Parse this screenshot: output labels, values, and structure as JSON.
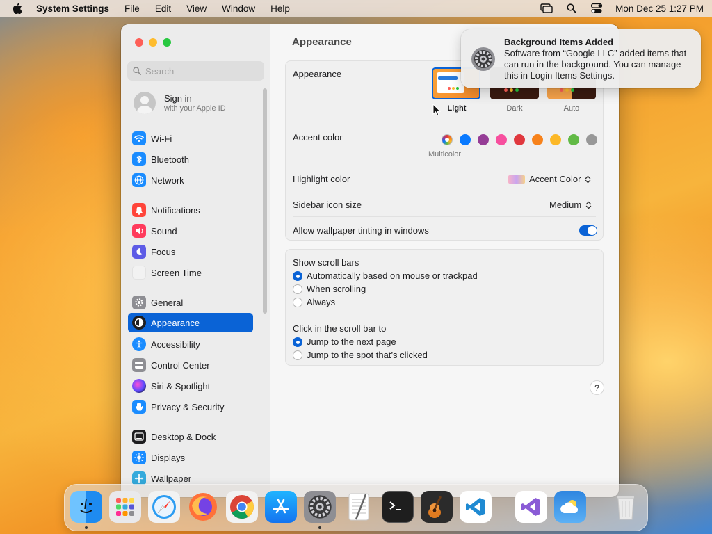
{
  "menubar": {
    "app_name": "System Settings",
    "menus": [
      "File",
      "Edit",
      "View",
      "Window",
      "Help"
    ],
    "datetime": "Mon Dec 25  1:27 PM"
  },
  "sidebar": {
    "search_placeholder": "Search",
    "signin": {
      "title": "Sign in",
      "subtitle": "with your Apple ID"
    },
    "items": [
      {
        "label": "Wi-Fi",
        "icon": "wifi-icon",
        "color": "#1a8cff"
      },
      {
        "label": "Bluetooth",
        "icon": "bluetooth-icon",
        "color": "#1a8cff"
      },
      {
        "label": "Network",
        "icon": "globe-icon",
        "color": "#1a8cff"
      },
      {
        "label": "Notifications",
        "icon": "bell-icon",
        "color": "#ff453a"
      },
      {
        "label": "Sound",
        "icon": "speaker-icon",
        "color": "#ff3b5c"
      },
      {
        "label": "Focus",
        "icon": "moon-icon",
        "color": "#5e5ce6"
      },
      {
        "label": "Screen Time",
        "icon": "hourglass-icon",
        "color": "#f2f2f2"
      },
      {
        "label": "General",
        "icon": "gear-icon",
        "color": "#8e8e93"
      },
      {
        "label": "Appearance",
        "icon": "appearance-icon",
        "color": "#1d1d1f",
        "active": true
      },
      {
        "label": "Accessibility",
        "icon": "accessibility-icon",
        "color": "#1a8cff"
      },
      {
        "label": "Control Center",
        "icon": "control-center-icon",
        "color": "#8e8e93"
      },
      {
        "label": "Siri & Spotlight",
        "icon": "siri-icon",
        "color": "#222222"
      },
      {
        "label": "Privacy & Security",
        "icon": "hand-icon",
        "color": "#1a8cff"
      },
      {
        "label": "Desktop & Dock",
        "icon": "dock-icon",
        "color": "#1d1d1f"
      },
      {
        "label": "Displays",
        "icon": "sun-icon",
        "color": "#1a8cff"
      },
      {
        "label": "Wallpaper",
        "icon": "wallpaper-icon",
        "color": "#34aadc"
      }
    ]
  },
  "main": {
    "title": "Appearance",
    "appearance": {
      "label": "Appearance",
      "options": [
        {
          "label": "Light",
          "selected": true
        },
        {
          "label": "Dark",
          "selected": false
        },
        {
          "label": "Auto",
          "selected": false
        }
      ]
    },
    "accent": {
      "label": "Accent color",
      "selected_label": "Multicolor",
      "colors": [
        "multicolor",
        "#0a7aff",
        "#953d96",
        "#f74f9e",
        "#e0383e",
        "#f7821b",
        "#fcb827",
        "#62ba46",
        "#989898"
      ]
    },
    "highlight": {
      "label": "Highlight color",
      "value": "Accent Color"
    },
    "sidebar_icon_size": {
      "label": "Sidebar icon size",
      "value": "Medium"
    },
    "wallpaper_tinting": {
      "label": "Allow wallpaper tinting in windows",
      "on": true
    },
    "scroll_bars": {
      "label": "Show scroll bars",
      "options": [
        {
          "label": "Automatically based on mouse or trackpad",
          "selected": true
        },
        {
          "label": "When scrolling",
          "selected": false
        },
        {
          "label": "Always",
          "selected": false
        }
      ]
    },
    "click_scroll": {
      "label": "Click in the scroll bar to",
      "options": [
        {
          "label": "Jump to the next page",
          "selected": true
        },
        {
          "label": "Jump to the spot that’s clicked",
          "selected": false
        }
      ]
    },
    "help": "?"
  },
  "notification": {
    "title": "Background Items Added",
    "body": "Software from “Google LLC” added items that can run in the background. You can manage this in Login Items Settings."
  },
  "dock": {
    "apps": [
      "finder-icon",
      "launchpad-icon",
      "safari-icon",
      "firefox-icon",
      "chrome-icon",
      "app-store-icon",
      "system-settings-icon",
      "textedit-icon",
      "terminal-icon",
      "garageband-icon",
      "vscode-icon",
      "visual-studio-icon",
      "weather-icon",
      "trash-icon"
    ]
  }
}
